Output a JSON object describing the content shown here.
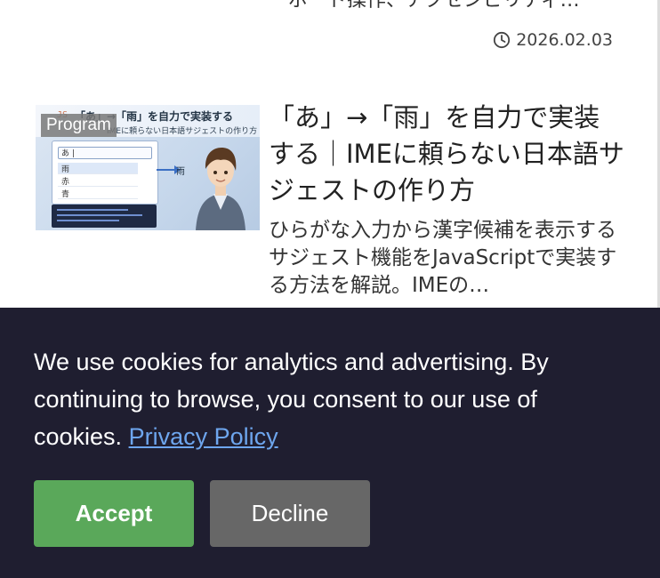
{
  "previous_article": {
    "excerpt_tail": "ーボード操作、アクセシビリティ…",
    "date": "2026.02.03",
    "date_icon": "clock-icon"
  },
  "article": {
    "category_badge": "Program",
    "title": "「あ」→「雨」を自力で実装する｜IMEに頼らない日本語サジェストの作り方",
    "excerpt": "ひらがな入力から漢字候補を表示するサジェスト機能をJavaScriptで実装する方法を解説。IMEの…",
    "thumbnail": {
      "js_tag": "JS",
      "title_text": "「あ」→「雨」を自力で実装する",
      "subtitle_text": "IMEに頼らない日本語サジェストの作り方",
      "input_value": "あ |",
      "suggestions": [
        "雨",
        "赤",
        "青"
      ],
      "arrow_result": "雨"
    }
  },
  "cookie_banner": {
    "message": "We use cookies for analytics and advertising. By continuing to browse, you consent to our use of cookies.",
    "link_text": "Privacy Policy",
    "accept_label": "Accept",
    "decline_label": "Decline",
    "colors": {
      "background": "#1f1e30",
      "accept": "#5aa85a",
      "decline": "#676767",
      "link": "#6ea6ee"
    }
  }
}
